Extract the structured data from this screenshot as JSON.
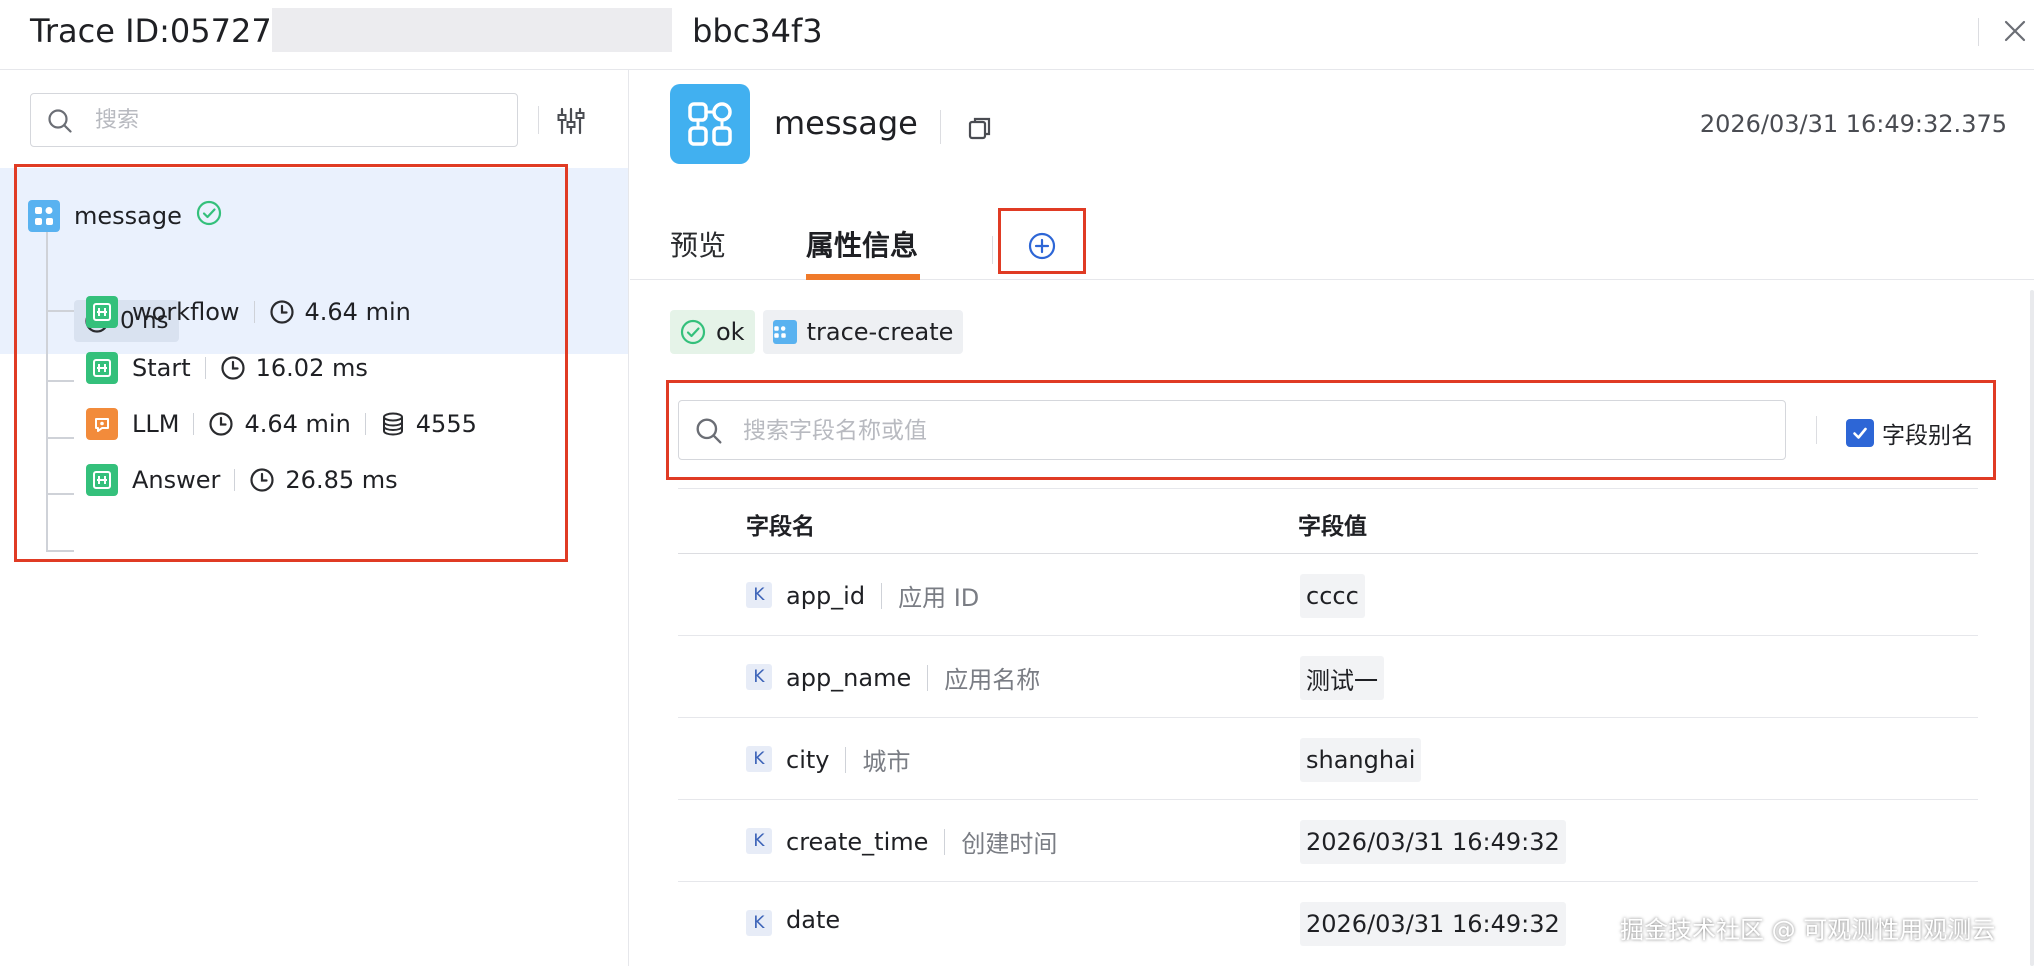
{
  "header": {
    "title_prefix": "Trace ID:057277",
    "title_suffix": "bbc34f3"
  },
  "left": {
    "search_placeholder": "搜索",
    "tree": {
      "root": {
        "label": "message",
        "status": "ok",
        "duration": "0 ns"
      },
      "children": [
        {
          "label": "workflow",
          "icon": "workflow-icon",
          "duration": "4.64 min"
        },
        {
          "label": "Start",
          "icon": "workflow-icon",
          "duration": "16.02 ms"
        },
        {
          "label": "LLM",
          "icon": "llm-icon",
          "duration": "4.64 min",
          "tokens": "4555"
        },
        {
          "label": "Answer",
          "icon": "workflow-icon",
          "duration": "26.85 ms"
        }
      ]
    }
  },
  "detail": {
    "span_name": "message",
    "timestamp": "2026/03/31 16:49:32.375",
    "tabs": [
      {
        "label": "预览",
        "active": false
      },
      {
        "label": "属性信息",
        "active": true
      }
    ],
    "badges": {
      "status": "ok",
      "source": "trace-create"
    },
    "field_search_placeholder": "搜索字段名称或值",
    "alias_toggle_label": "字段别名",
    "alias_checked": true,
    "table": {
      "headers": {
        "name": "字段名",
        "value": "字段值"
      },
      "rows": [
        {
          "key": "app_id",
          "alias": "应用 ID",
          "value": "cccc"
        },
        {
          "key": "app_name",
          "alias": "应用名称",
          "value": "测试一"
        },
        {
          "key": "city",
          "alias": "城市",
          "value": "shanghai"
        },
        {
          "key": "create_time",
          "alias": "创建时间",
          "value": "2026/03/31 16:49:32"
        },
        {
          "key": "date",
          "alias": "",
          "value": "2026/03/31 16:49:32"
        }
      ],
      "key_type_label": "K"
    }
  },
  "watermark": "掘金技术社区 @ 可观测性用观测云",
  "colors": {
    "accent_blue": "#2d66d6",
    "tab_underline": "#f07a2a",
    "highlight_box": "#e03b24",
    "ok_green": "#34c07b",
    "llm_orange": "#f28b3b"
  }
}
